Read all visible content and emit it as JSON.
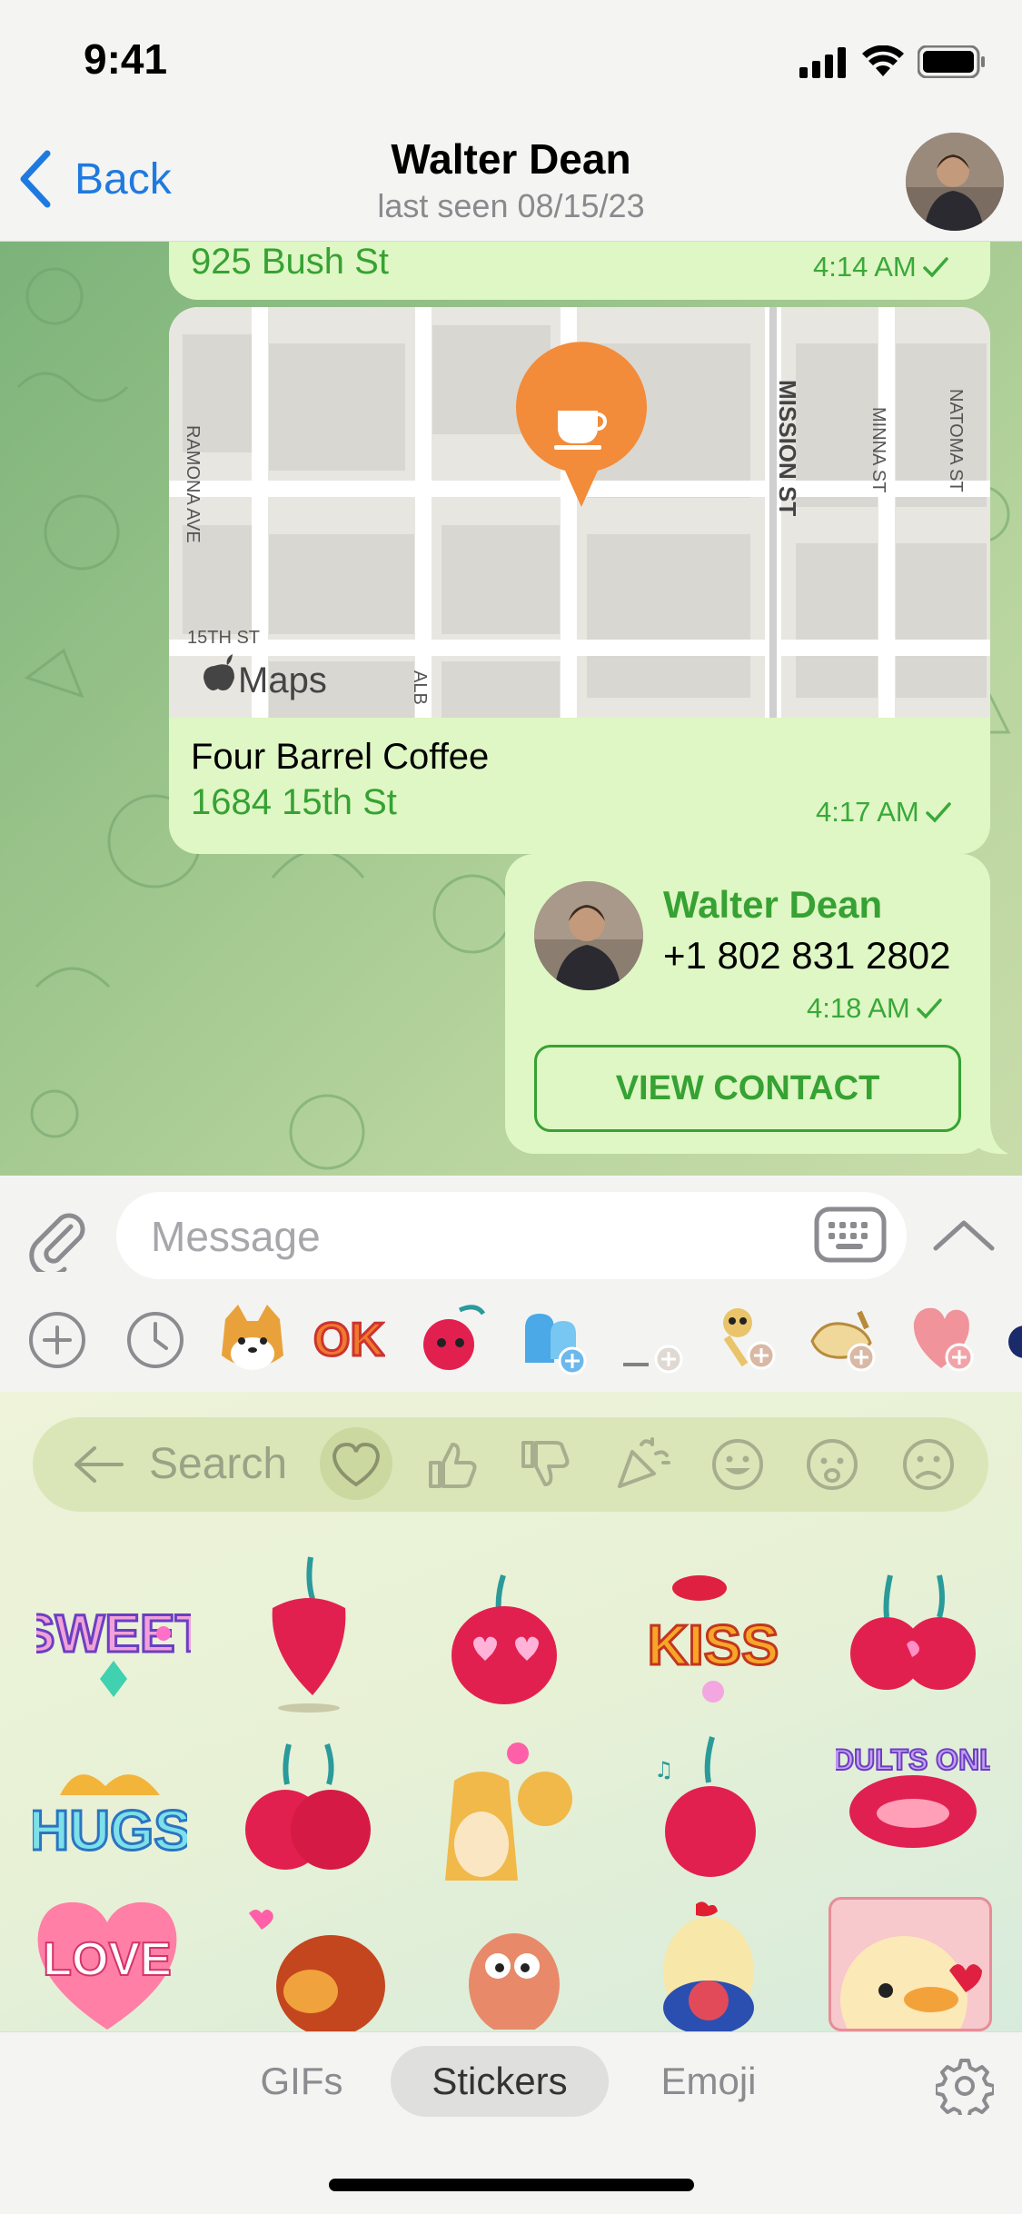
{
  "status_bar": {
    "time": "9:41"
  },
  "header": {
    "back_label": "Back",
    "title": "Walter Dean",
    "subtitle": "last seen 08/15/23"
  },
  "messages": {
    "address": {
      "text": "925 Bush St",
      "time": "4:14 AM"
    },
    "location": {
      "map_credit": "Maps",
      "streets": [
        "MISSION ST",
        "MINNA ST",
        "NATOMA ST",
        "15TH ST",
        "RAMONA AVE",
        "ALB"
      ],
      "venue_name": "Four Barrel Coffee",
      "venue_address": "1684 15th St",
      "time": "4:17 AM"
    },
    "contact": {
      "name": "Walter Dean",
      "phone": "+1 802 831 2802",
      "time": "4:18 AM",
      "button_label": "VIEW CONTACT"
    }
  },
  "composer": {
    "placeholder": "Message"
  },
  "sticker_strip": {
    "items": [
      "add-pack-icon",
      "recent-icon",
      "shiba-sticker",
      "ok-sticker",
      "cherry-sticker",
      "blue-sticker",
      "pack-sticker",
      "pack-sticker",
      "pack-sticker",
      "heart-sticker"
    ],
    "ok_label": "OK"
  },
  "sticker_panel": {
    "search_placeholder": "Search",
    "categories": [
      "heart-icon",
      "thumbs-up-icon",
      "thumbs-down-icon",
      "party-icon",
      "smile-icon",
      "worried-icon",
      "sad-icon"
    ],
    "stickers": [
      {
        "name": "sweet-sticker",
        "label": "SWEET"
      },
      {
        "name": "cherry-sticker",
        "label": ""
      },
      {
        "name": "cherry-love-sticker",
        "label": ""
      },
      {
        "name": "kiss-sticker",
        "label": "KISS"
      },
      {
        "name": "cherry-pair-sticker",
        "label": ""
      },
      {
        "name": "hugs-sticker",
        "label": "HUGS"
      },
      {
        "name": "cherry-kiss-sticker",
        "label": ""
      },
      {
        "name": "shiba-muscle-sticker",
        "label": ""
      },
      {
        "name": "cherry-music-sticker",
        "label": ""
      },
      {
        "name": "adults-only-sticker",
        "label": "ADULTS ONLY"
      },
      {
        "name": "love-sticker",
        "label": "LOVE"
      },
      {
        "name": "dog-sticker",
        "label": ""
      },
      {
        "name": "shrimp-sticker",
        "label": ""
      },
      {
        "name": "chicken-sticker",
        "label": ""
      },
      {
        "name": "duck-sticker",
        "label": ""
      }
    ]
  },
  "tabs": {
    "gifs": "GIFs",
    "stickers": "Stickers",
    "emoji": "Emoji",
    "active": "Stickers"
  },
  "colors": {
    "accent": "#1f7ae0",
    "bubble": "#dff7c4",
    "green_text": "#36a233"
  }
}
